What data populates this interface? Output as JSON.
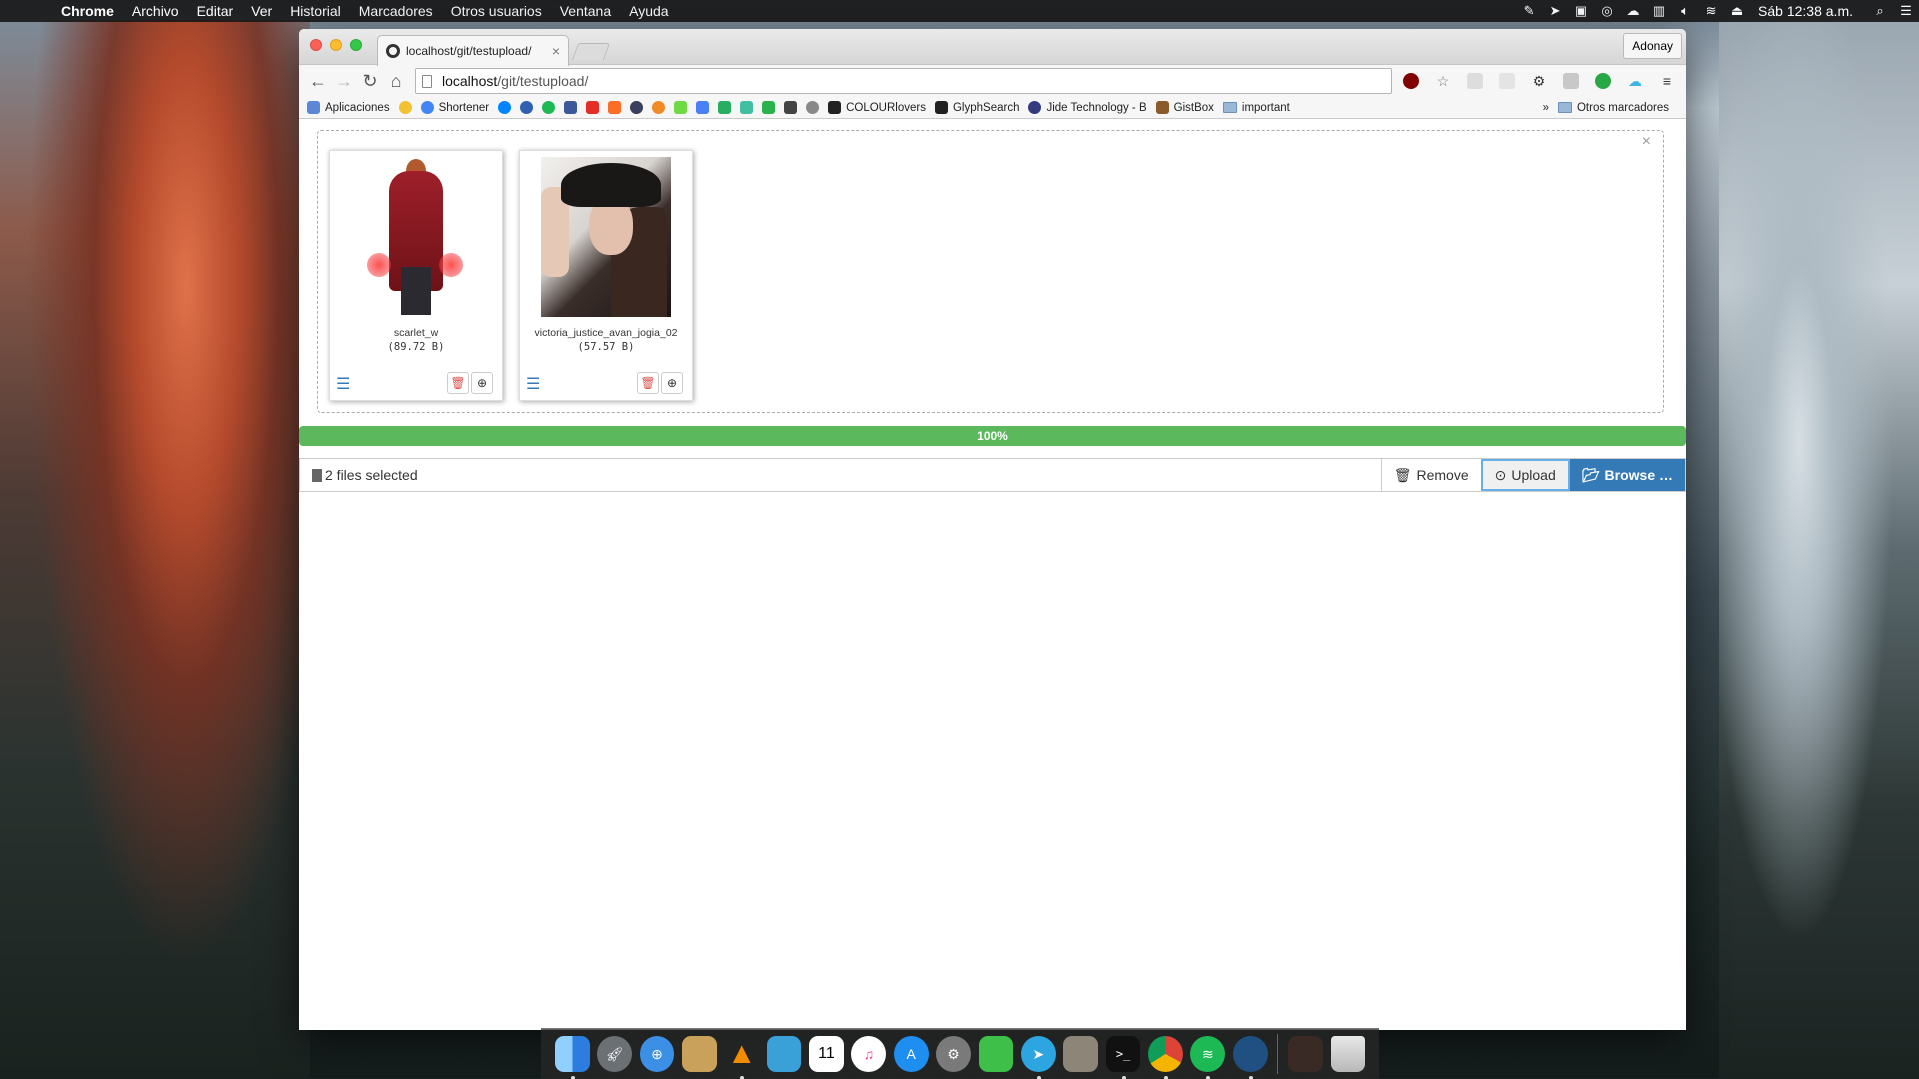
{
  "menubar": {
    "app_name": "Chrome",
    "menus": [
      "Archivo",
      "Editar",
      "Ver",
      "Historial",
      "Marcadores",
      "Otros usuarios",
      "Ventana",
      "Ayuda"
    ],
    "clock": "Sáb 12:38 a.m."
  },
  "browser": {
    "tab_title": "localhost/git/testupload/",
    "tab_close": "×",
    "profile": "Adonay",
    "url_host": "localhost",
    "url_path": "/git/testupload/",
    "bookmarks": {
      "apps": "Aplicaciones",
      "shortener": "Shortener",
      "colourlovers": "COLOURlovers",
      "glyphsearch": "GlyphSearch",
      "jide": "Jide Technology - B",
      "gistbox": "GistBox",
      "important": "important",
      "more": "»",
      "other": "Otros marcadores"
    }
  },
  "uploader": {
    "close": "×",
    "files": [
      {
        "name": "scarlet_w",
        "size": "(89.72 B)"
      },
      {
        "name": "victoria_justice_avan_jogia_02",
        "size": "(57.57 B)"
      }
    ],
    "progress_label": "100%",
    "progress_value": 100,
    "caption": "2 files selected",
    "remove_label": "Remove",
    "upload_label": "Upload",
    "browse_label": "Browse …"
  },
  "colors": {
    "progress": "#5cb85c",
    "primary": "#337ab7",
    "danger": "#d9534f"
  }
}
